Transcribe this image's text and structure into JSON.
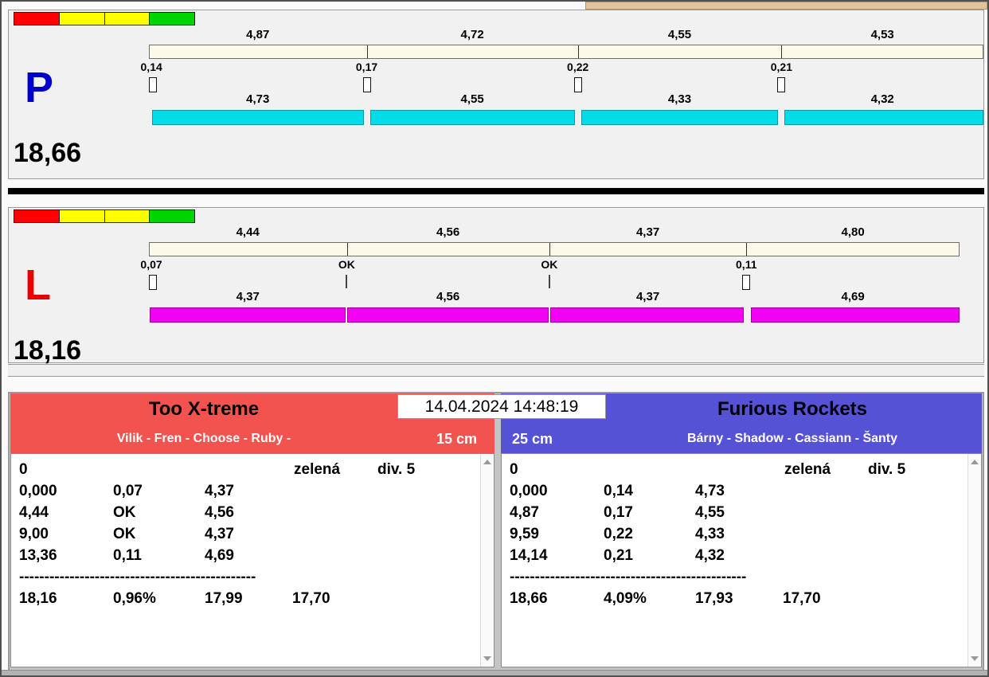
{
  "window": {
    "datetime": "14.04.2024 14:48:19"
  },
  "lanes": [
    {
      "label": "P",
      "total": "18,66",
      "top_values": [
        "4,87",
        "4,72",
        "4,55",
        "4,53"
      ],
      "splits": [
        "0,14",
        "0,17",
        "0,22",
        "0,21"
      ],
      "bottom_values": [
        "4,73",
        "4,55",
        "4,33",
        "4,32"
      ]
    },
    {
      "label": "L",
      "total": "18,16",
      "top_values": [
        "4,44",
        "4,56",
        "4,37",
        "4,80"
      ],
      "splits": [
        "0,07",
        "OK",
        "OK",
        "0,11"
      ],
      "bottom_values": [
        "4,37",
        "4,56",
        "4,37",
        "4,69"
      ]
    }
  ],
  "teams": [
    {
      "name": "Too X-treme",
      "members": "Vilik - Fren - Choose - Ruby -",
      "distance": "15 cm",
      "table": {
        "lane_no": "0",
        "color_label": "zelená",
        "division": "div. 5",
        "rows": [
          [
            "0,000",
            "0,07",
            "4,37"
          ],
          [
            "4,44",
            "OK",
            "4,56"
          ],
          [
            "9,00",
            "OK",
            "4,37"
          ],
          [
            "13,36",
            "0,11",
            "4,69"
          ]
        ],
        "separator": "-----------------------------------------------",
        "summary": [
          "18,16",
          "0,96%",
          "17,99",
          "17,70"
        ]
      }
    },
    {
      "name": "Furious Rockets",
      "members": "Bárny - Shadow - Cassiann - Šanty",
      "distance": "25 cm",
      "table": {
        "lane_no": "0",
        "color_label": "zelená",
        "division": "div. 5",
        "rows": [
          [
            "0,000",
            "0,14",
            "4,73"
          ],
          [
            "4,87",
            "0,17",
            "4,55"
          ],
          [
            "9,59",
            "0,22",
            "4,33"
          ],
          [
            "14,14",
            "0,21",
            "4,32"
          ]
        ],
        "separator": "-----------------------------------------------",
        "summary": [
          "18,66",
          "4,09%",
          "17,93",
          "17,70"
        ]
      }
    }
  ],
  "colors": {
    "lane_p_label": "#0000cd",
    "lane_l_label": "#e60000",
    "top_bar": "#fbfae8",
    "p_bottom_bar": "#00dde8",
    "l_bottom_bar": "#f400f4",
    "team_left_header": "#f2534e",
    "team_right_header": "#5552d5",
    "light_red": "#ff0000",
    "light_yellow": "#ffff00",
    "light_green": "#00d400"
  }
}
